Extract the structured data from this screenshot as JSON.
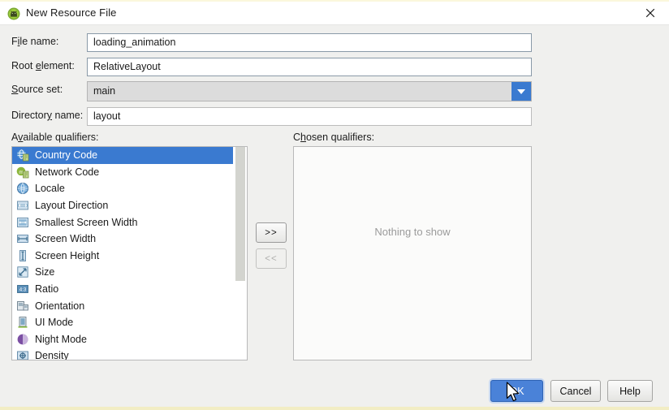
{
  "window": {
    "title": "New Resource File",
    "app_icon": "android-green-icon",
    "close_icon": "close-icon"
  },
  "form": {
    "fields": [
      {
        "label_pre": "F",
        "label_mn": "i",
        "label_post": "le name:",
        "value": "loading_animation",
        "name": "file-name",
        "type": "text"
      },
      {
        "label_pre": "Root ",
        "label_mn": "e",
        "label_post": "lement:",
        "value": "RelativeLayout",
        "name": "root-element",
        "type": "text"
      },
      {
        "label_pre": "",
        "label_mn": "S",
        "label_post": "ource set:",
        "value": "main",
        "name": "source-set",
        "type": "combo"
      },
      {
        "label_pre": "Director",
        "label_mn": "y",
        "label_post": " name:",
        "value": "layout",
        "name": "directory-name",
        "type": "text"
      }
    ]
  },
  "qualifiers": {
    "available_label_pre": "A",
    "available_label_mn": "v",
    "available_label_post": "ailable qualifiers:",
    "chosen_label_pre": "C",
    "chosen_label_mn": "h",
    "chosen_label_post": "osen qualifiers:",
    "available": [
      {
        "label": "Country Code",
        "icon": "country-code-icon",
        "selected": true
      },
      {
        "label": "Network Code",
        "icon": "network-code-icon",
        "selected": false
      },
      {
        "label": "Locale",
        "icon": "locale-globe-icon",
        "selected": false
      },
      {
        "label": "Layout Direction",
        "icon": "layout-direction-icon",
        "selected": false
      },
      {
        "label": "Smallest Screen Width",
        "icon": "smallest-screen-width-icon",
        "selected": false
      },
      {
        "label": "Screen Width",
        "icon": "screen-width-icon",
        "selected": false
      },
      {
        "label": "Screen Height",
        "icon": "screen-height-icon",
        "selected": false
      },
      {
        "label": "Size",
        "icon": "size-icon",
        "selected": false
      },
      {
        "label": "Ratio",
        "icon": "ratio-icon",
        "selected": false
      },
      {
        "label": "Orientation",
        "icon": "orientation-icon",
        "selected": false
      },
      {
        "label": "UI Mode",
        "icon": "ui-mode-icon",
        "selected": false
      },
      {
        "label": "Night Mode",
        "icon": "night-mode-icon",
        "selected": false
      },
      {
        "label": "Density",
        "icon": "density-icon",
        "selected": false
      }
    ],
    "chosen_empty_text": "Nothing to show",
    "add_button": ">>",
    "remove_button": "<<"
  },
  "footer": {
    "ok": "OK",
    "cancel": "Cancel",
    "help": "Help"
  },
  "colors": {
    "accent_blue": "#3a7ad0",
    "primary_button": "#4a82d8",
    "dialog_bg": "#f0f0ee",
    "selection": "#3a7ad0",
    "edge_strip": "#f2edc4"
  }
}
